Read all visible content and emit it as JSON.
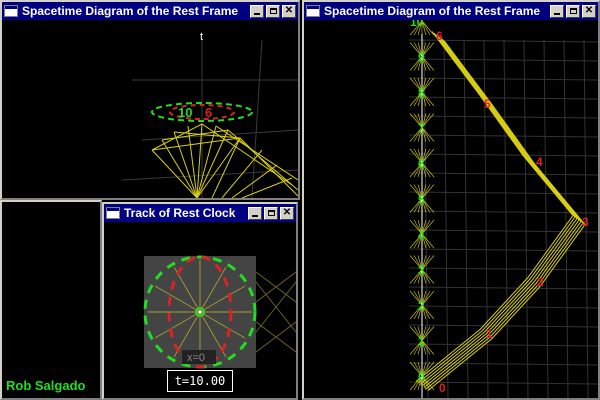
{
  "windows": {
    "spacetime_left": {
      "title": "Spacetime Diagram of the Rest Frame"
    },
    "spacetime_right": {
      "title": "Spacetime Diagram of the Rest Frame"
    },
    "track": {
      "title": "Track of Rest Clock"
    }
  },
  "left_view": {
    "axis_label": "t",
    "green_tick": "10",
    "red_tick": "6"
  },
  "right_view": {
    "green_ticks": [
      "0",
      "1",
      "2",
      "3",
      "4",
      "5",
      "6",
      "7",
      "8",
      "9",
      "10"
    ],
    "red_ticks": [
      "0",
      "1",
      "2",
      "3",
      "4",
      "5",
      "6"
    ]
  },
  "track_view": {
    "x_readout": "x=0"
  },
  "status": {
    "time_readout": "t=10.00",
    "author": "Rob Salgado"
  },
  "colors": {
    "green": "#22dd22",
    "red": "#dd2222",
    "yellow": "#d8d010",
    "titlebar": "#000080"
  }
}
